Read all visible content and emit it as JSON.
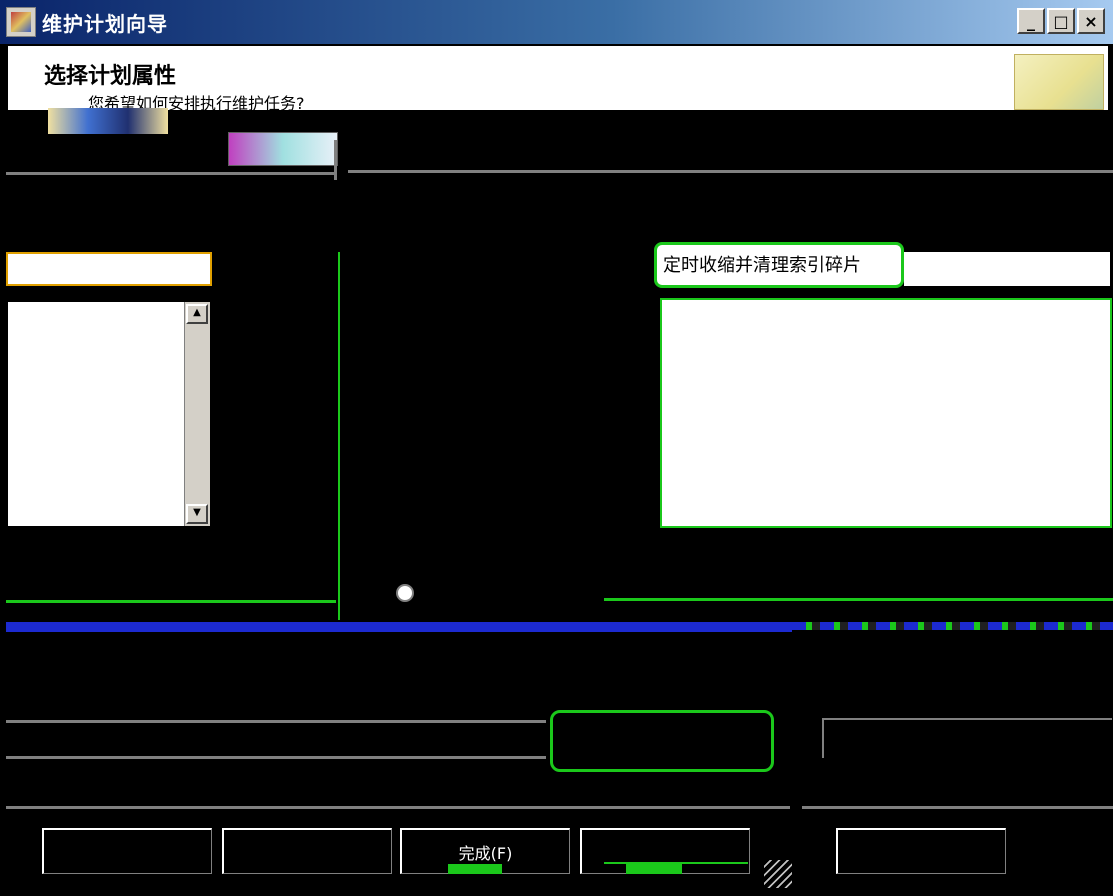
{
  "window": {
    "title": "维护计划向导",
    "controls": [
      "_",
      "□",
      "×"
    ]
  },
  "header": {
    "heading": "选择计划属性",
    "subheading": "您希望如何安排执行维护任务?"
  },
  "form": {
    "name_value": "定时收缩并清理索引碎片"
  },
  "buttons": {
    "finish": "完成(F)"
  },
  "icons": {
    "app": "maintenance-wizard-icon",
    "header": "wizard-graphic-icon",
    "scroll_up": "arrow-up-icon",
    "scroll_down": "arrow-down-icon",
    "resize": "resize-grip-icon"
  },
  "colors": {
    "titlebar_start": "#0a246a",
    "titlebar_end": "#a6caf0",
    "highlight": "#1bc81b",
    "accent_bar": "#1c2ad0"
  }
}
